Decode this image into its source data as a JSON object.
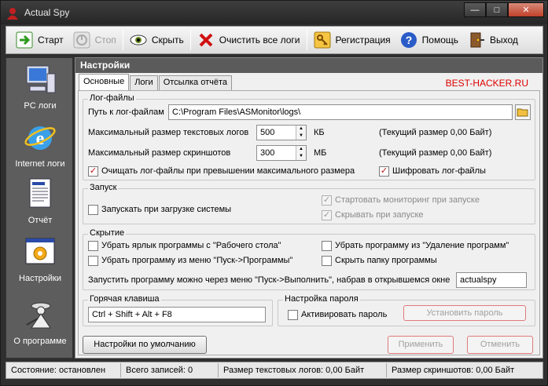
{
  "window": {
    "title": "Actual Spy",
    "min": "—",
    "max": "□",
    "close": "✕"
  },
  "toolbar": {
    "start": "Старт",
    "stop": "Стоп",
    "hide": "Скрыть",
    "clear_logs": "Очистить все логи",
    "register": "Регистрация",
    "help": "Помощь",
    "exit": "Выход"
  },
  "sidebar": {
    "pc_logs": "PC логи",
    "internet_logs": "Internet логи",
    "report": "Отчёт",
    "settings": "Настройки",
    "about": "О программе"
  },
  "main": {
    "header": "Настройки",
    "brand": "BEST-HACKER.RU",
    "tabs": [
      "Основные",
      "Логи",
      "Отсылка отчёта"
    ]
  },
  "logfiles": {
    "title": "Лог-файлы",
    "path_label": "Путь к лог-файлам",
    "path_value": "C:\\Program Files\\ASMonitor\\logs\\",
    "text_max_label": "Максимальный размер текстовых логов",
    "text_max_value": "500",
    "text_unit": "КБ",
    "text_current": "(Текущий размер 0,00 Байт)",
    "shot_max_label": "Максимальный размер скриншотов",
    "shot_max_value": "300",
    "shot_unit": "МБ",
    "shot_current": "(Текущий размер 0,00 Байт)",
    "clear_on_exceed": "Очищать лог-файлы при превышении максимального размера",
    "encrypt": "Шифровать лог-файлы"
  },
  "startup": {
    "title": "Запуск",
    "run_on_boot": "Запускать при загрузке системы",
    "start_monitoring": "Стартовать мониторинг при запуске",
    "hide_on_start": "Скрывать при запуске"
  },
  "hiding": {
    "title": "Скрытие",
    "remove_desktop": "Убрать ярлык программы с \"Рабочего стола\"",
    "remove_startmenu": "Убрать программу из меню \"Пуск->Программы\"",
    "remove_uninstall": "Убрать программу из \"Удаление программ\"",
    "hide_folder": "Скрыть папку программы",
    "run_hint": "Запустить программу можно через меню \"Пуск->Выполнить\", набрав в открывшемся окне",
    "run_value": "actualspy"
  },
  "hotkey": {
    "title": "Горячая клавиша",
    "value": "Ctrl + Shift + Alt + F8"
  },
  "password": {
    "title": "Настройка пароля",
    "activate": "Активировать пароль",
    "set_button": "Установить пароль"
  },
  "buttons": {
    "defaults": "Настройки по умолчанию",
    "apply": "Применить",
    "cancel": "Отменить"
  },
  "status": {
    "state": "Состояние: остановлен",
    "records": "Всего записей: 0",
    "text_size": "Размер текстовых логов: 0,00 Байт",
    "shot_size": "Размер скриншотов: 0,00 Байт"
  }
}
